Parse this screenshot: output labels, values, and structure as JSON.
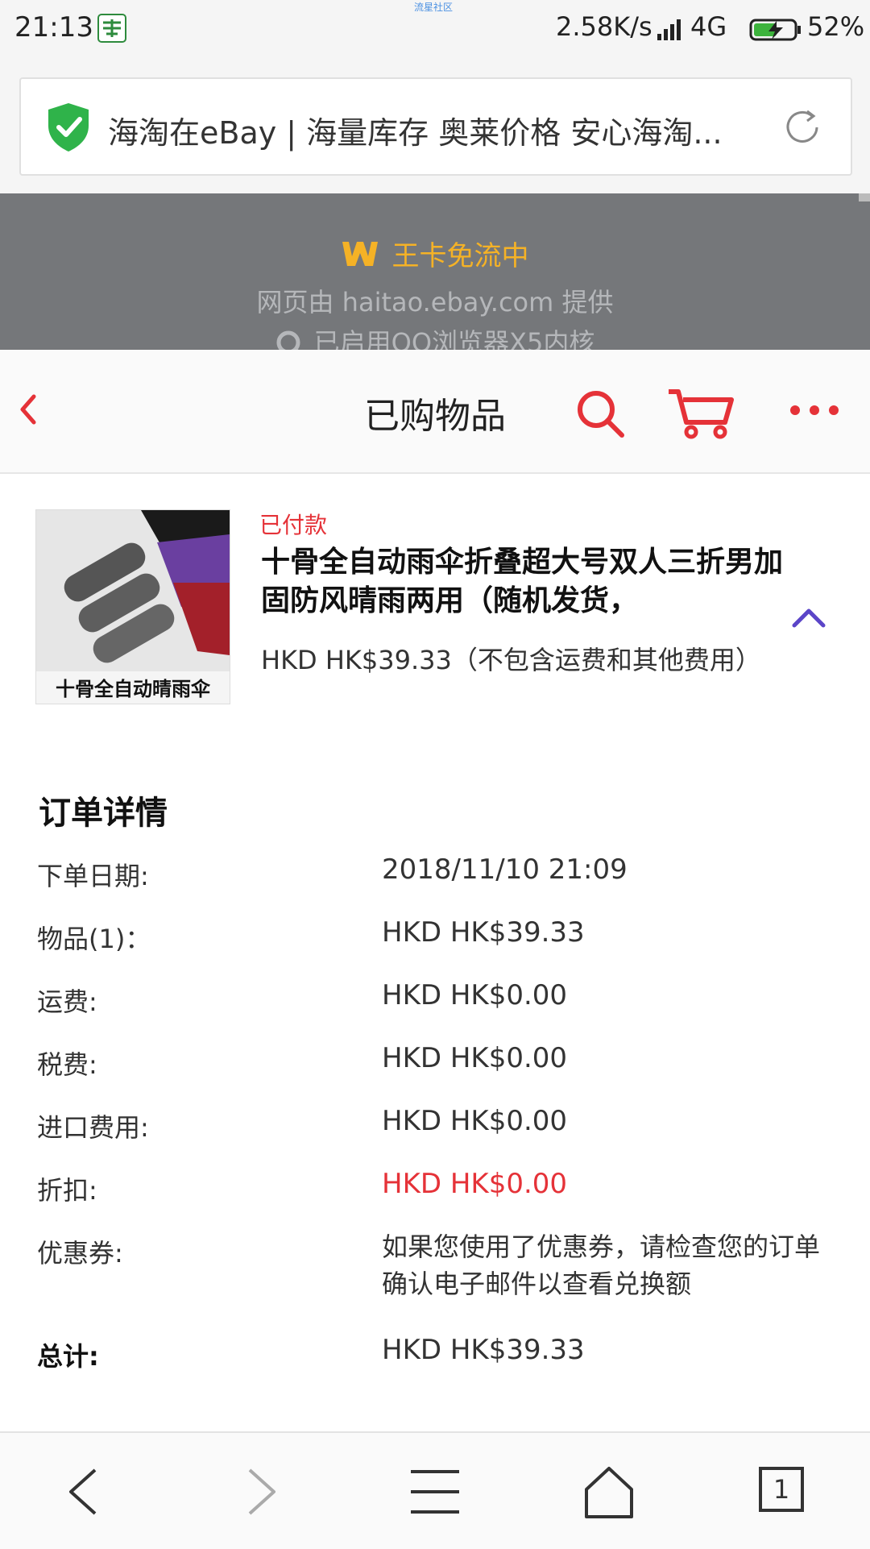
{
  "status_bar": {
    "time": "21:13",
    "watermark": "流星社区",
    "speed": "2.58K/s",
    "network": "4G",
    "battery": "52%"
  },
  "browser": {
    "page_title": "海淘在eBay | 海量库存 奥莱价格 安心海淘...",
    "wang_card": "王卡免流中",
    "provider": "网页由 haitao.ebay.com 提供",
    "x5_notice": "已启用QQ浏览器X5内核",
    "tab_count": "1"
  },
  "header": {
    "title": "已购物品"
  },
  "product": {
    "status": "已付款",
    "title": "十骨全自动雨伞折叠超大号双人三折男加固防风晴雨两用（随机发货，",
    "price_note": " HKD HK$39.33（不包含运费和其他费用）",
    "image_caption": "十骨全自动晴雨伞"
  },
  "order": {
    "heading": "订单详情",
    "rows": [
      {
        "label": "下单日期:",
        "value": "2018/11/10 21:09"
      },
      {
        "label": "物品(1)：",
        "value": "HKD HK$39.33"
      },
      {
        "label": "运费:",
        "value": "HKD HK$0.00"
      },
      {
        "label": "税费:",
        "value": "HKD HK$0.00"
      },
      {
        "label": "进口费用:",
        "value": "HKD HK$0.00"
      },
      {
        "label": "折扣:",
        "value": "HKD HK$0.00"
      },
      {
        "label": "优惠券:",
        "value": "如果您使用了优惠券，请检查您的订单确认电子邮件以查看兑换额"
      },
      {
        "label": "总计:",
        "value": "HKD HK$39.33"
      }
    ]
  },
  "colors": {
    "accent_red": "#e53238",
    "wang_gold": "#f5b226",
    "collapse_purple": "#5b45c8"
  }
}
